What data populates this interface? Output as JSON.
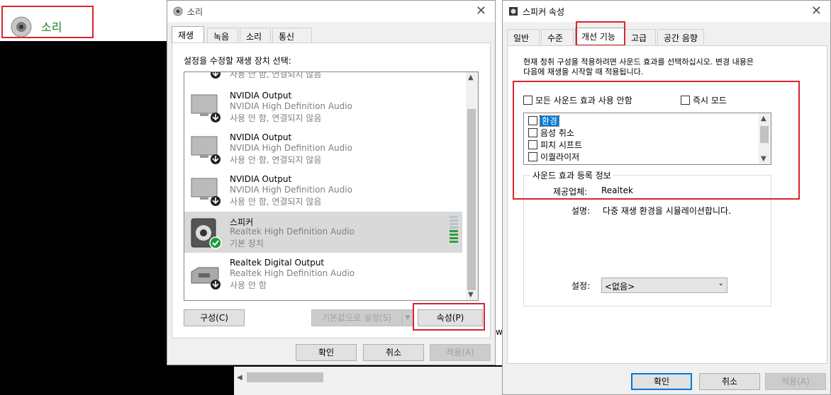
{
  "sound_item": {
    "label": "소리",
    "icon": "speaker-icon"
  },
  "sound_dialog": {
    "title": "소리",
    "tabs": [
      "재생",
      "녹음",
      "소리",
      "통신"
    ],
    "instruction": "설정을 수정할 재생 장치 선택:",
    "devices": [
      {
        "name": "",
        "driver": "",
        "status": "사용 안 함, 연결되지 않음"
      },
      {
        "name": "NVIDIA Output",
        "driver": "NVIDIA High Definition Audio",
        "status": "사용 안 함, 연결되지 않음"
      },
      {
        "name": "NVIDIA Output",
        "driver": "NVIDIA High Definition Audio",
        "status": "사용 안 함, 연결되지 않음"
      },
      {
        "name": "NVIDIA Output",
        "driver": "NVIDIA High Definition Audio",
        "status": "사용 안 함, 연결되지 않음"
      },
      {
        "name": "스피커",
        "driver": "Realtek High Definition Audio",
        "status": "기본 장치"
      },
      {
        "name": "Realtek Digital Output",
        "driver": "Realtek High Definition Audio",
        "status": "사용 안 함"
      }
    ],
    "configure_label": "구성(C)",
    "set_default_label": "기본값으로 설정(S)",
    "properties_label": "속성(P)",
    "ok_label": "확인",
    "cancel_label": "취소",
    "apply_label": "적용(A)"
  },
  "speaker_props": {
    "title": "스피커 속성",
    "tabs": [
      "일반",
      "수준",
      "개선 기능",
      "고급",
      "공간 음향"
    ],
    "description_line1": "현재 청취 구성을 적용하려면 사운드 효과를 선택하십시오. 변경 내용은",
    "description_line2": "다음에 재생을 시작할 때 적용됩니다.",
    "disable_all_label": "모든 사운드 효과 사용 안함",
    "immediate_mode_label": "즉시 모드",
    "effects": [
      "환경",
      "음성 취소",
      "피치 시프트",
      "이퀄라이저"
    ],
    "group_label": "사운드 효과 등록 정보",
    "provider_label": "제공업체:",
    "provider_value": "Realtek",
    "description_label": "설명:",
    "description_value": "다중 재생 환경을 시뮬레이션합니다.",
    "setting_label": "설정:",
    "setting_value": "<없음>",
    "ok_label": "확인",
    "cancel_label": "취소",
    "apply_label": "적용(A)"
  },
  "stray_char": "w",
  "colors": {
    "highlight": "#d9252c",
    "select_blue": "#0078d7",
    "green_label": "#1a7a1a"
  }
}
